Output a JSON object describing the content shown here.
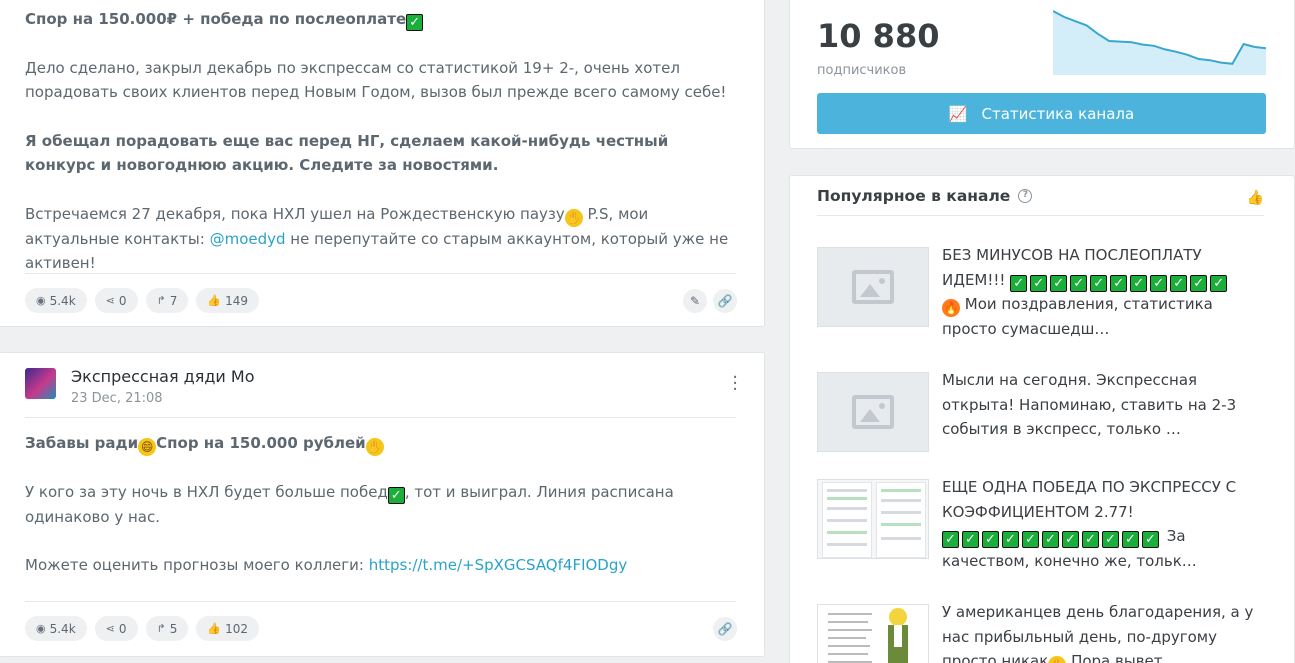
{
  "post1": {
    "title": "Спор на 150.000₽ + победа по послеоплате",
    "para1": "Дело сделано, закрыл декабрь по экспрессам со статистикой 19+ 2-, очень хотел порадовать своих клиентов перед Новым Годом, вызов был прежде всего самому себе!",
    "para2": "Я обещал порадовать еще вас перед НГ, сделаем какой-нибудь честный конкурс и новогоднюю акцию. Следите за новостями.",
    "para3_a": "Встречаемся 27 декабря, пока НХЛ ушел на Рождественскую паузу",
    "para3_b": " P.S, мои актуальные контакты: ",
    "para3_link": "@moedyd",
    "para3_c": " не перепутайте со старым аккаунтом, который уже не активен!",
    "views": "5.4k",
    "shares": "0",
    "forwards": "7",
    "likes": "149"
  },
  "post2": {
    "channel_name": "Экспрессная дяди Мо",
    "date": "23 Dec, 21:08",
    "title_a": "Забавы ради",
    "title_b": "Спор на 150.000 рублей",
    "para1_a": "У кого за эту ночь в НХЛ будет больше побед",
    "para1_b": ", тот и выиграл. Линия расписана одинаково у нас.",
    "para2_a": "Можете оценить прогнозы моего коллеги: ",
    "para2_link": "https://t.me/+SpXGCSAQf4FIODgy",
    "views": "5.4k",
    "shares": "0",
    "forwards": "5",
    "likes": "102"
  },
  "subscribers": {
    "count": "10 880",
    "label": "подписчиков",
    "button_label": "Статистика канала",
    "trend": [
      1.0,
      0.9,
      0.83,
      0.76,
      0.62,
      0.5,
      0.49,
      0.48,
      0.44,
      0.42,
      0.36,
      0.32,
      0.27,
      0.2,
      0.18,
      0.14,
      0.12,
      0.45,
      0.4,
      0.38
    ]
  },
  "popular": {
    "title": "Популярное в канале",
    "items": [
      {
        "text_a": "БЕЗ МИНУСОВ НА ПОСЛЕОПЛАТУ ИДЕМ!!! ",
        "text_b": " Мои поздравления, статистика просто сумасшедш…",
        "checks": 11,
        "fire": true
      },
      {
        "text_a": " Мысли на сегодня. Экспрессная открыта! Напоминаю, ставить на 2-3 события в экспресс, только …"
      },
      {
        "text_a": "ЕЩЕ ОДНА ПОБЕДА ПО ЭКСПРЕССУ С КОЭФФИЦИЕНТОМ 2.77!",
        "text_b": " За качеством, конечно же, тольк…",
        "checks": 11
      },
      {
        "text_a": "У американцев день благодарения, а у нас прибыльный день, по-другому просто никак",
        "text_b": " Пора вывет…"
      }
    ]
  },
  "colors": {
    "accent": "#4cb4dc",
    "link": "#29a3c9",
    "check": "#1aae3a"
  }
}
